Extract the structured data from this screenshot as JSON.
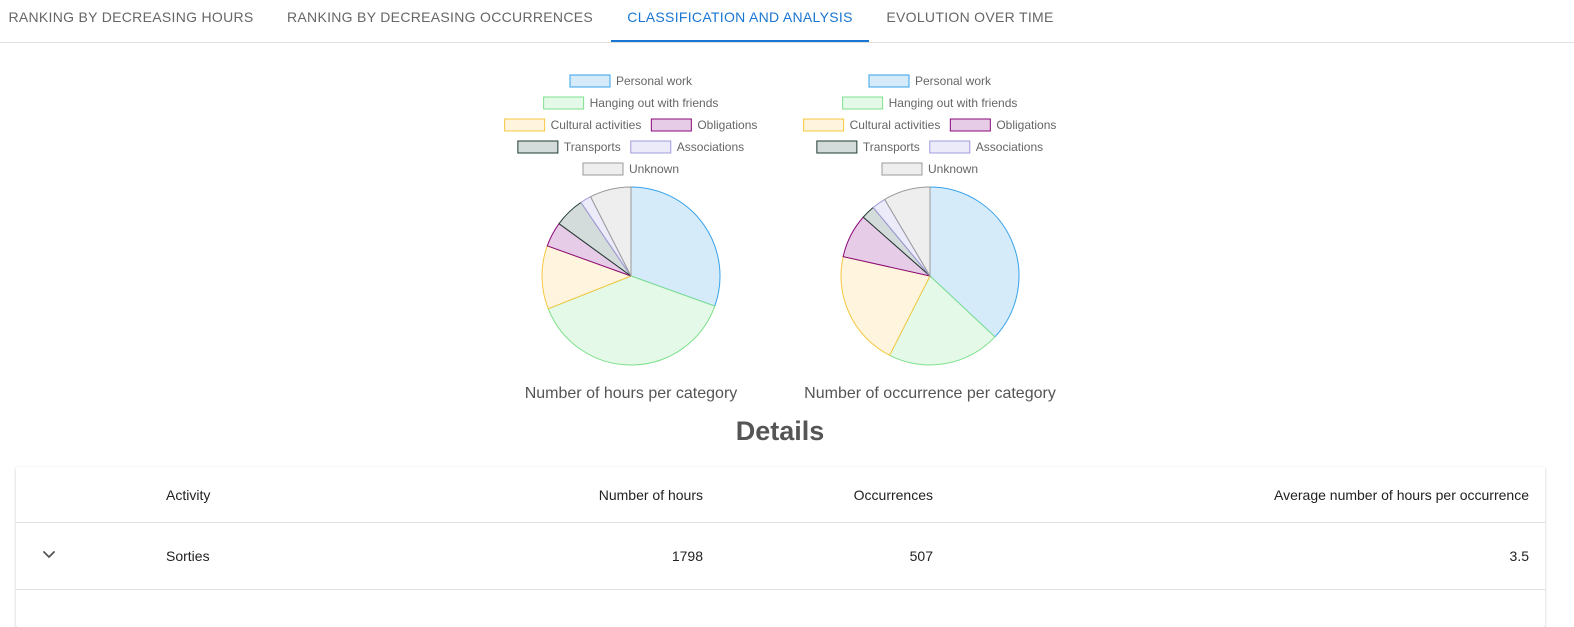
{
  "tabs": [
    {
      "label": "RANKING BY DECREASING HOURS",
      "active": false
    },
    {
      "label": "RANKING BY DECREASING OCCURRENCES",
      "active": false
    },
    {
      "label": "CLASSIFICATION AND ANALYSIS",
      "active": true
    },
    {
      "label": "EVOLUTION OVER TIME",
      "active": false
    }
  ],
  "chart_data": [
    {
      "type": "pie",
      "title": "Number of hours per category",
      "legend_position": "top",
      "categories": [
        "Personal work",
        "Hanging out with friends",
        "Cultural activities",
        "Obligations",
        "Transports",
        "Associations",
        "Unknown"
      ],
      "values": [
        30.5,
        38.5,
        11.5,
        4.5,
        5.5,
        2.0,
        7.5
      ]
    },
    {
      "type": "pie",
      "title": "Number of occurrence per category",
      "legend_position": "top",
      "categories": [
        "Personal work",
        "Hanging out with friends",
        "Cultural activities",
        "Obligations",
        "Transports",
        "Associations",
        "Unknown"
      ],
      "values": [
        37.0,
        20.5,
        21.0,
        8.0,
        2.5,
        2.5,
        8.5
      ]
    }
  ],
  "category_colors": [
    {
      "fill": "#d6ebfa",
      "stroke": "#36a2eb"
    },
    {
      "fill": "#e5f9e8",
      "stroke": "#7ee08c"
    },
    {
      "fill": "#fff5de",
      "stroke": "#f5c842"
    },
    {
      "fill": "#e6cce6",
      "stroke": "#8b0a7a"
    },
    {
      "fill": "#d3dcda",
      "stroke": "#1e3a30"
    },
    {
      "fill": "#ecebfa",
      "stroke": "#a29cdc"
    },
    {
      "fill": "#eeeeee",
      "stroke": "#9a9a9a"
    }
  ],
  "details": {
    "title": "Details",
    "headers": {
      "activity": "Activity",
      "hours": "Number of hours",
      "occurrences": "Occurrences",
      "average": "Average number of hours per occurrence"
    },
    "rows": [
      {
        "activity": "Sorties",
        "hours": "1798",
        "occurrences": "507",
        "average": "3.5"
      }
    ]
  }
}
